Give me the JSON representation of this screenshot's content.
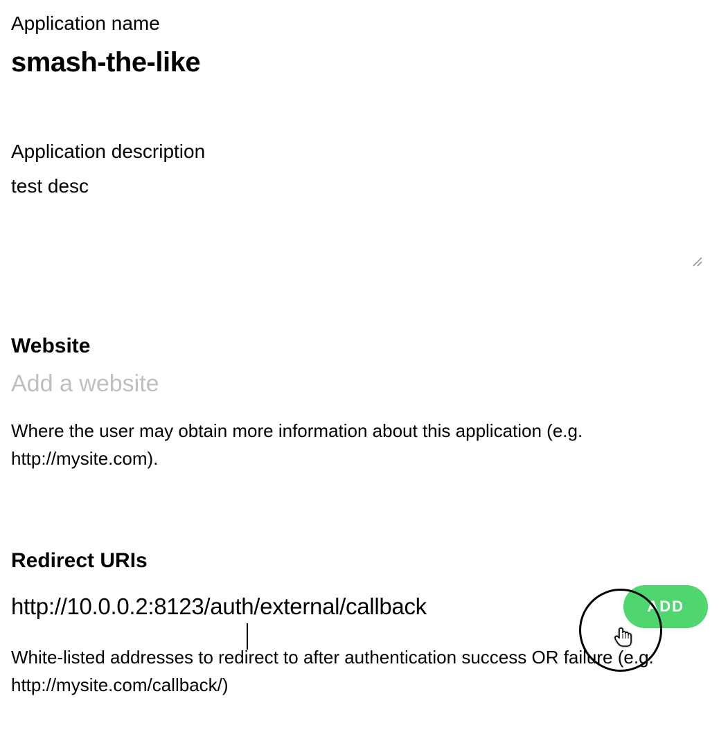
{
  "app_name": {
    "label": "Application name",
    "value": "smash-the-like"
  },
  "app_description": {
    "label": "Application description",
    "value": "test desc"
  },
  "website": {
    "heading": "Website",
    "placeholder": "Add a website",
    "value": "",
    "helper": "Where the user may obtain more information about this application (e.g. http://mysite.com)."
  },
  "redirect": {
    "heading": "Redirect URIs",
    "value": "http://10.0.0.2:8123/auth/external/callback",
    "add_label": "ADD",
    "helper": "White-listed addresses to redirect to after authentication success OR failure (e.g. http://mysite.com/callback/)"
  },
  "colors": {
    "add_button_bg": "#4fd66e"
  }
}
